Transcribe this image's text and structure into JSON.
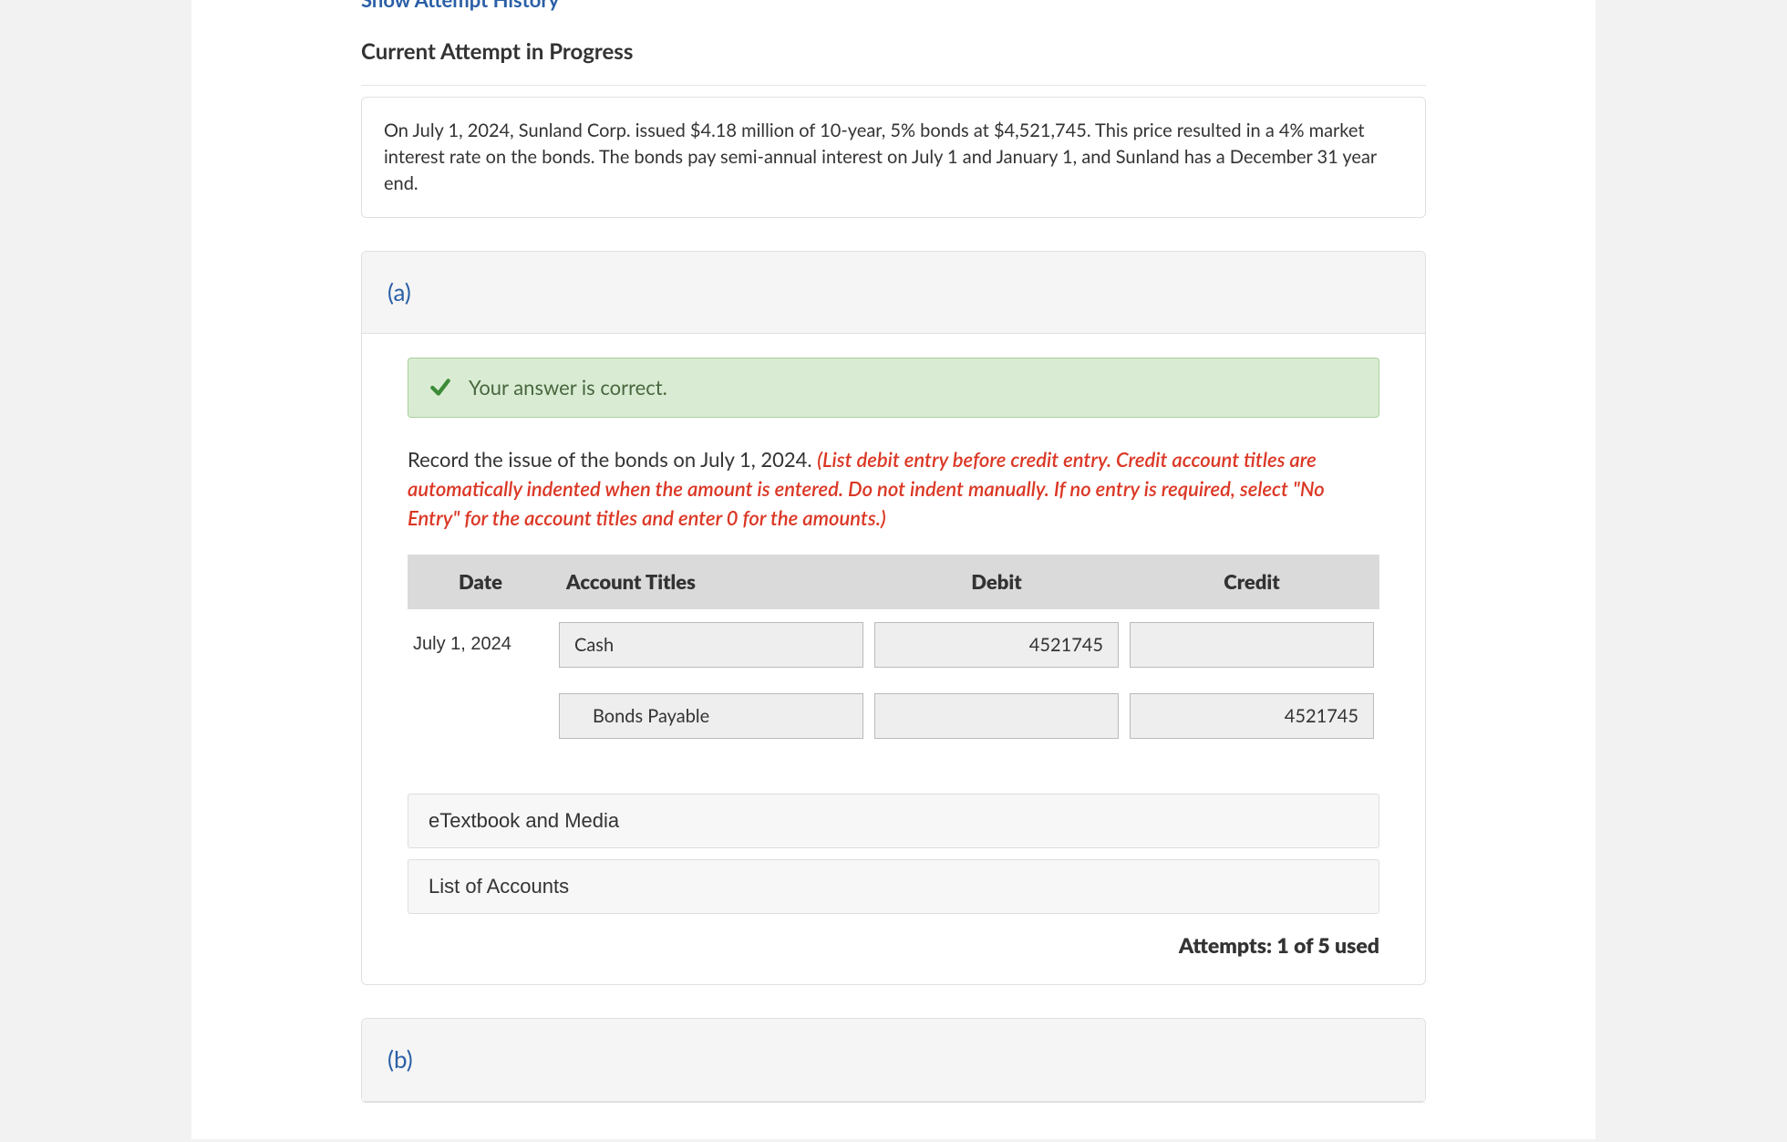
{
  "header": {
    "history_link": "Show Attempt History",
    "attempt_heading": "Current Attempt in Progress"
  },
  "problem": {
    "text": "On July 1, 2024, Sunland Corp. issued $4.18 million of 10-year, 5% bonds at $4,521,745. This price resulted in a 4% market interest rate on the bonds. The bonds pay semi-annual interest on July 1 and January 1, and Sunland has a December 31 year end."
  },
  "part_a": {
    "label": "(a)",
    "feedback": "Your answer is correct.",
    "instruction_plain": "Record the issue of the bonds on July 1, 2024. ",
    "instruction_red": "(List debit entry before credit entry. Credit account titles are automatically indented when the amount is entered. Do not indent manually. If no entry is required, select \"No Entry\" for the account titles and enter 0 for the amounts.)",
    "columns": {
      "date": "Date",
      "acct": "Account Titles",
      "debit": "Debit",
      "credit": "Credit"
    },
    "rows": [
      {
        "date": "July 1, 2024",
        "account": "Cash",
        "debit": "4521745",
        "credit": "",
        "indent": false
      },
      {
        "date": "",
        "account": "Bonds Payable",
        "debit": "",
        "credit": "4521745",
        "indent": true
      }
    ],
    "resources": {
      "etextbook": "eTextbook and Media",
      "list_accounts": "List of Accounts"
    },
    "attempts_used": "Attempts: 1 of 5 used"
  },
  "part_b": {
    "label": "(b)"
  }
}
